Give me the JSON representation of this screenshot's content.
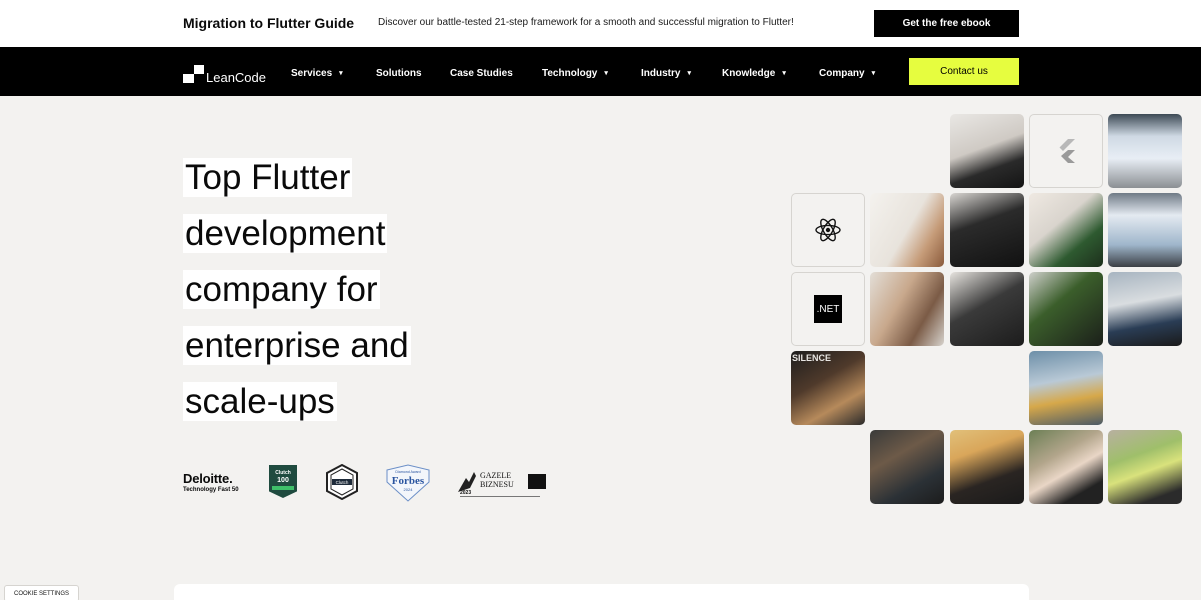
{
  "promo": {
    "title": "Migration to Flutter Guide",
    "text": "Discover our battle-tested 21-step framework for a smooth and successful migration to Flutter!",
    "button_label": "Get the free ebook"
  },
  "nav": {
    "logo_text": "LeanCode",
    "items": [
      {
        "label": "Services",
        "dropdown": "▾"
      },
      {
        "label": "Solutions"
      },
      {
        "label": "Case Studies"
      },
      {
        "label": "Technology",
        "dropdown": "▾"
      },
      {
        "label": "Industry",
        "dropdown": "▾"
      },
      {
        "label": "Knowledge",
        "dropdown": "▾"
      },
      {
        "label": "Company",
        "dropdown": "▾"
      }
    ],
    "contact_label": "Contact us"
  },
  "hero": {
    "title_lines": [
      "Top Flutter",
      "development",
      "company for",
      "enterprise and",
      "scale-ups"
    ]
  },
  "awards": {
    "deloitte_name": "Deloitte.",
    "deloitte_sub": "Technology Fast 50",
    "clutch100_top": "Clutch",
    "clutch100_number": "100",
    "clutch_badge": "Clutch",
    "forbes_top": "Diamond Award",
    "forbes_name": "Forbes",
    "forbes_year": "2024",
    "gazele_title": "GAZELE",
    "gazele_sub": "BIZNESU",
    "gazele_year": "2023"
  },
  "grid": {
    "net_label": ".NET",
    "silence_text": "SILENCE"
  },
  "cookie_label": "COOKIE SETTINGS",
  "colors": {
    "accent": "#e6fd3f",
    "nav_bg": "#000000",
    "page_bg": "#f3f2f0"
  }
}
